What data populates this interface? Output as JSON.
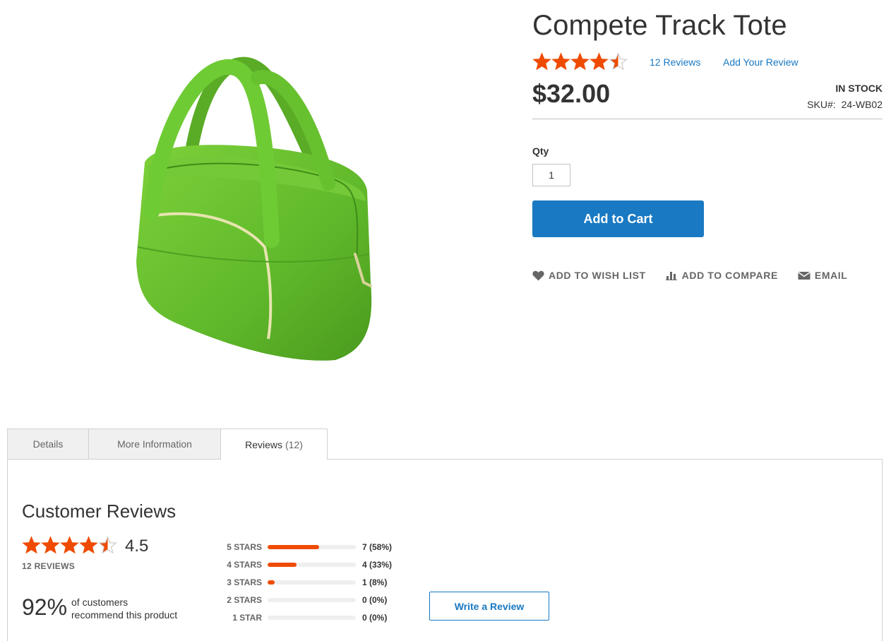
{
  "product": {
    "name": "Compete Track Tote",
    "image_alt": "green tote bag",
    "rating": 4.5,
    "reviews_link": "12 Reviews",
    "add_review_link": "Add Your Review",
    "price": "$32.00",
    "stock": "IN STOCK",
    "sku_label": "SKU#:",
    "sku": "24-WB02",
    "qty_label": "Qty",
    "qty_value": "1",
    "add_to_cart": "Add to Cart",
    "actions": {
      "wishlist": "ADD TO WISH LIST",
      "compare": "ADD TO COMPARE",
      "email": "EMAIL"
    }
  },
  "tabs": {
    "details": "Details",
    "more_info": "More Information",
    "reviews": "Reviews",
    "reviews_count": "(12)",
    "active": "reviews"
  },
  "customer_reviews": {
    "title": "Customer Reviews",
    "average": "4.5",
    "count_label": "12 REVIEWS",
    "recommend_pct": "92%",
    "recommend_line1": "of customers",
    "recommend_line2": "recommend this product",
    "breakdown": [
      {
        "label": "5 STARS",
        "value": "7 (58%)",
        "fraction": 0.58
      },
      {
        "label": "4 STARS",
        "value": "4 (33%)",
        "fraction": 0.33
      },
      {
        "label": "3 STARS",
        "value": "1 (8%)",
        "fraction": 0.08
      },
      {
        "label": "2 STARS",
        "value": "0 (0%)",
        "fraction": 0
      },
      {
        "label": "1 STAR",
        "value": "0 (0%)",
        "fraction": 0
      }
    ],
    "write_review": "Write a Review"
  },
  "colors": {
    "star": "#ef4b00",
    "link": "#1979c3",
    "primary_button": "#1979c3",
    "bag_green": "#6cc531"
  }
}
